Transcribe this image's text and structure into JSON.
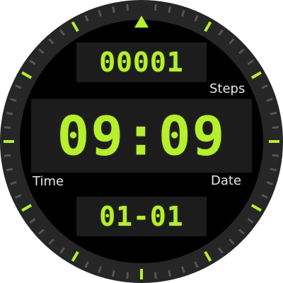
{
  "watch_face": {
    "steps": {
      "value": "00001",
      "label": "Steps"
    },
    "time": {
      "value": "09:09",
      "label": "Time"
    },
    "date": {
      "value": "01-01",
      "label": "Date"
    }
  },
  "colors": {
    "lcd_accent": "#b6ef2e",
    "bezel": "#262626",
    "face": "#000000",
    "minute_ticks": "#555555",
    "label_text": "#e8e8e8",
    "lcd_panel": "#1c1c1c"
  },
  "icons": {
    "top_marker": "triangle-pointer-icon"
  }
}
